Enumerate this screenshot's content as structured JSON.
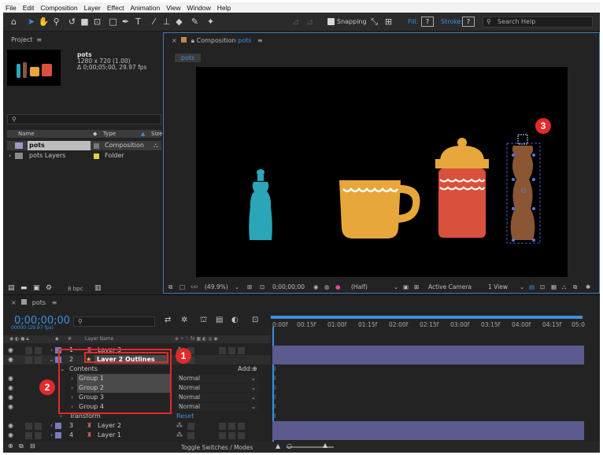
{
  "menu": [
    "File",
    "Edit",
    "Composition",
    "Layer",
    "Effect",
    "Animation",
    "View",
    "Window",
    "Help"
  ],
  "toolbar": {
    "snapping_label": "Snapping",
    "fill_label": "Fill:",
    "fill_value": "?",
    "stroke_label": "Stroke:",
    "stroke_value": "?",
    "search_help": "Search Help"
  },
  "project": {
    "title": "Project",
    "comp_name": "pots",
    "comp_size": "1280 x 720 (1.00)",
    "comp_duration": "Δ 0;00;05;00, 29.97 fps",
    "col_name": "Name",
    "col_type": "Type",
    "col_size": "Size",
    "items": [
      {
        "name": "pots",
        "type": "Composition"
      },
      {
        "name": "pots Layers",
        "type": "Folder"
      }
    ],
    "bpc": "8 bpc"
  },
  "composition": {
    "title": "Composition",
    "comp_name": "pots",
    "tab": "pots",
    "zoom": "(49.9%)",
    "timecode": "0;00;00;00",
    "resolution": "(Half)",
    "camera": "Active Camera",
    "views": "1 View"
  },
  "timeline": {
    "comp_tab": "pots",
    "current_time": "0;00;00;00",
    "frame_info": "00000 (29.97 fps)",
    "col_layer_name": "Layer Name",
    "ruler": [
      "0:00f",
      "00:15f",
      "01:00f",
      "01:15f",
      "02:00f",
      "02:15f",
      "03:00f",
      "03:15f",
      "04:00f",
      "04:15f",
      "05:0"
    ],
    "layers": [
      {
        "num": "1",
        "name": "Layer 3"
      },
      {
        "num": "2",
        "name": "Layer 2 Outlines"
      },
      {
        "num": "3",
        "name": "Layer 2"
      },
      {
        "num": "4",
        "name": "Layer 1"
      }
    ],
    "contents_label": "Contents",
    "add_label": "Add:",
    "groups": [
      "Group 1",
      "Group 2",
      "Group 3",
      "Group 4"
    ],
    "blend_mode": "Normal",
    "transform_label": "Transform",
    "reset_label": "Reset",
    "toggle_label": "Toggle Switches / Modes"
  },
  "callouts": [
    "1",
    "2",
    "3"
  ],
  "colors": {
    "accent": "#3d8fe0",
    "callout": "#e12a2a",
    "layer_bar": "#5b5b8f",
    "teal_pot": "#2aa6b8",
    "yellow_cup": "#e8a73a",
    "red_pot": "#d9513c",
    "brown_grinder": "#8a5634"
  }
}
